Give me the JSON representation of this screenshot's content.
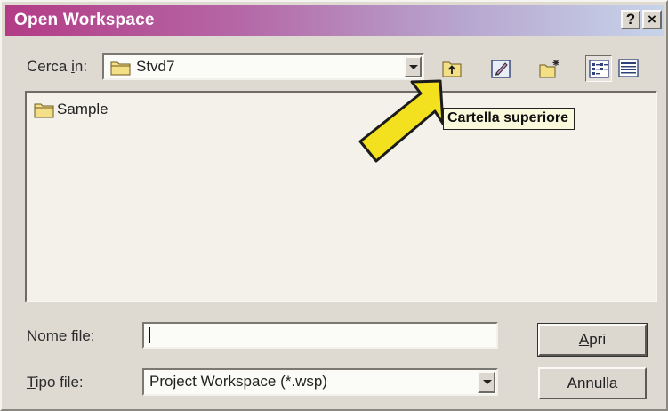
{
  "window": {
    "title": "Open Workspace",
    "help_label": "?",
    "close_label": "×"
  },
  "toolbar": {
    "look_in_label_pre": "Cerca ",
    "look_in_label_ul": "i",
    "look_in_label_post": "n:",
    "look_in_value": "Stvd7",
    "buttons": [
      {
        "name": "up-one-level",
        "icon": "folder-up-icon"
      },
      {
        "name": "desktop",
        "icon": "desktop-icon"
      },
      {
        "name": "new-folder",
        "icon": "new-folder-icon"
      },
      {
        "name": "list-view",
        "icon": "list-view-icon"
      },
      {
        "name": "details-view",
        "icon": "details-view-icon"
      }
    ]
  },
  "files": [
    {
      "label": "Sample",
      "icon": "folder-icon"
    }
  ],
  "tooltip": "Cartella superiore",
  "annotation": {
    "icon": "pointer-arrow-icon",
    "color": "#f3e01e"
  },
  "form": {
    "filename_label_ul": "N",
    "filename_label_rest": "ome file:",
    "filename_value": "",
    "filetype_label_ul": "T",
    "filetype_label_rest": "ipo file:",
    "filetype_value": "Project Workspace (*.wsp)"
  },
  "actions": {
    "open_ul": "A",
    "open_rest": "pri",
    "cancel_label": "Annulla"
  },
  "colors": {
    "title_start": "#b33c86",
    "title_end": "#c7d4ea",
    "tooltip_bg": "#fbf9dc"
  }
}
